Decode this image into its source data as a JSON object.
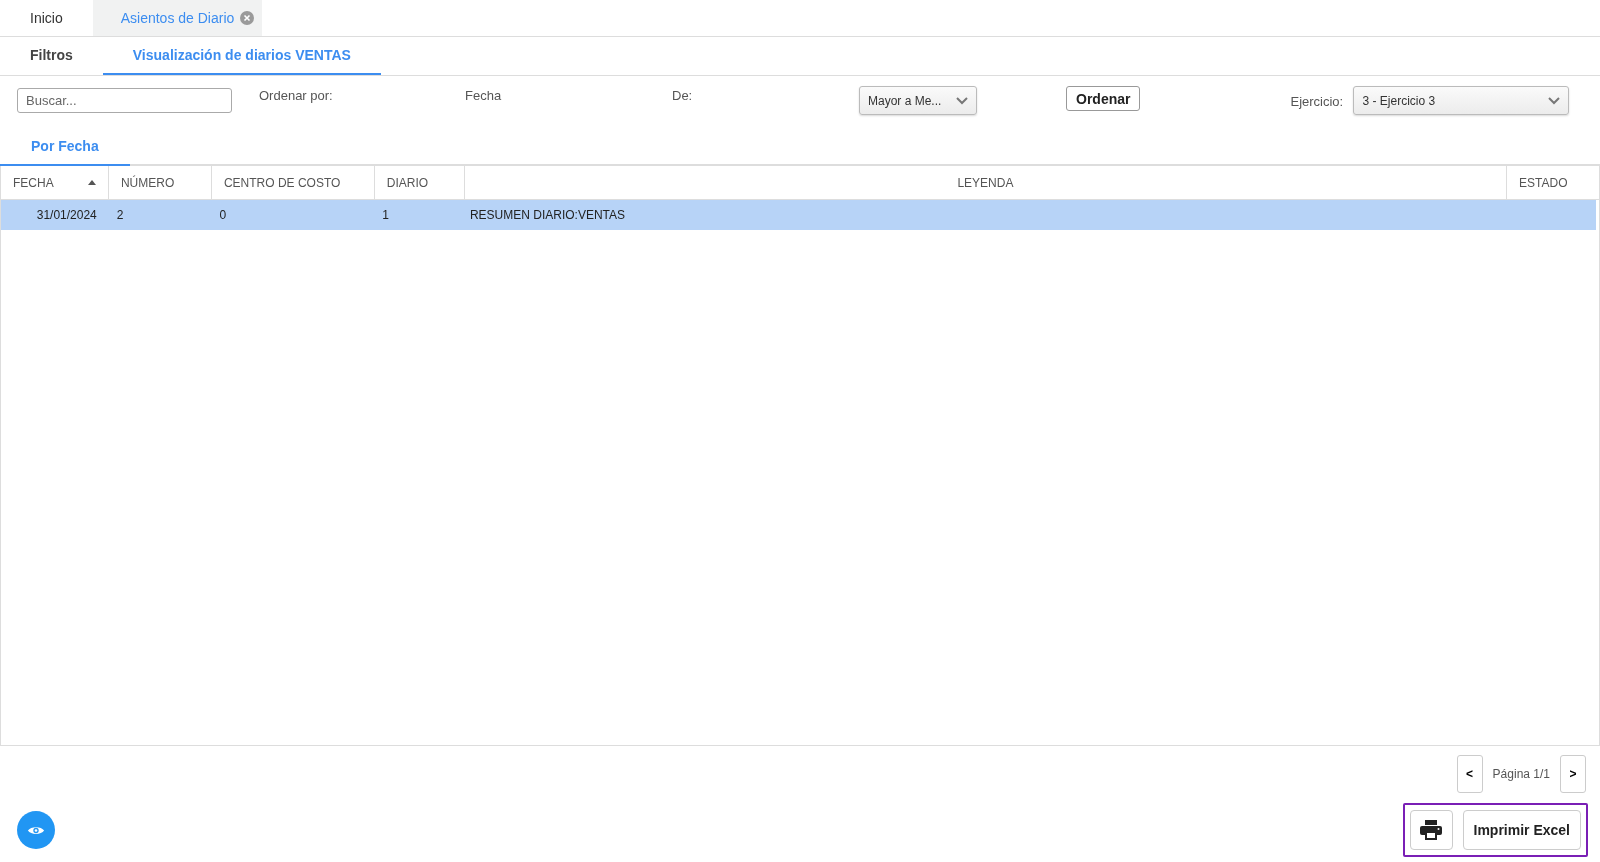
{
  "top_tabs": [
    {
      "label": "Inicio",
      "selected": false,
      "closable": false
    },
    {
      "label": "Asientos de Diario",
      "selected": true,
      "closable": true
    }
  ],
  "sub_tabs": [
    {
      "label": "Filtros",
      "selected": false
    },
    {
      "label": "Visualización de diarios VENTAS",
      "selected": true
    }
  ],
  "filters": {
    "search": {
      "placeholder": "Buscar..."
    },
    "order_label": "Ordenar por:",
    "order_field": "Fecha",
    "direction_label": "De:",
    "direction_select": "Mayor a Me...",
    "order_button": "Ordenar",
    "exercise_label": "Ejercicio:",
    "exercise_select": "3 - Ejercicio 3"
  },
  "view_tabs": [
    {
      "label": "Por Fecha",
      "selected": true
    }
  ],
  "table": {
    "columns": [
      {
        "label": "FECHA",
        "sorted": true
      },
      {
        "label": "NÚMERO",
        "sorted": false
      },
      {
        "label": "CENTRO DE COSTO",
        "sorted": false
      },
      {
        "label": "DIARIO",
        "sorted": false
      },
      {
        "label": "LEYENDA",
        "sorted": false
      },
      {
        "label": "ESTADO",
        "sorted": false
      }
    ],
    "rows": [
      {
        "cells": [
          "31/01/2024",
          "2",
          "0",
          "1",
          "RESUMEN DIARIO:VENTAS",
          ""
        ],
        "selected": true
      }
    ]
  },
  "pagination": {
    "prev": "<",
    "page": "Página 1/1",
    "next": ">"
  },
  "excel_button": "Imprimir Excel"
}
